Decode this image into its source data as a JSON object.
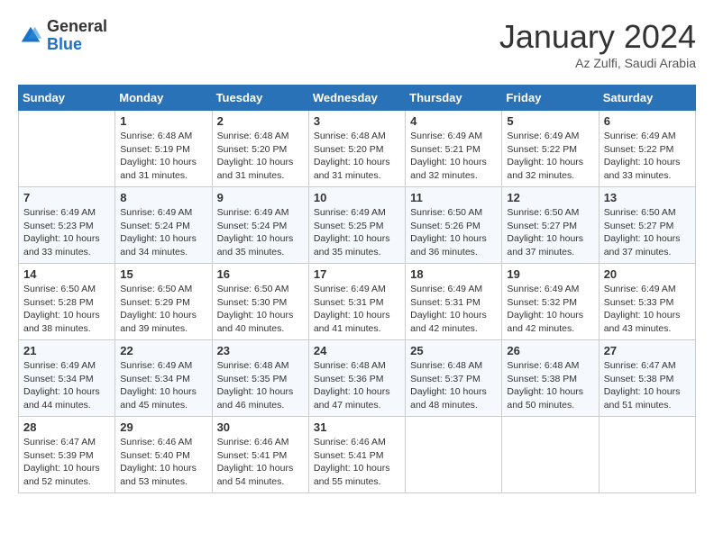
{
  "header": {
    "logo_general": "General",
    "logo_blue": "Blue",
    "month_title": "January 2024",
    "subtitle": "Az Zulfi, Saudi Arabia"
  },
  "weekdays": [
    "Sunday",
    "Monday",
    "Tuesday",
    "Wednesday",
    "Thursday",
    "Friday",
    "Saturday"
  ],
  "weeks": [
    [
      {
        "day": "",
        "info": ""
      },
      {
        "day": "1",
        "info": "Sunrise: 6:48 AM\nSunset: 5:19 PM\nDaylight: 10 hours\nand 31 minutes."
      },
      {
        "day": "2",
        "info": "Sunrise: 6:48 AM\nSunset: 5:20 PM\nDaylight: 10 hours\nand 31 minutes."
      },
      {
        "day": "3",
        "info": "Sunrise: 6:48 AM\nSunset: 5:20 PM\nDaylight: 10 hours\nand 31 minutes."
      },
      {
        "day": "4",
        "info": "Sunrise: 6:49 AM\nSunset: 5:21 PM\nDaylight: 10 hours\nand 32 minutes."
      },
      {
        "day": "5",
        "info": "Sunrise: 6:49 AM\nSunset: 5:22 PM\nDaylight: 10 hours\nand 32 minutes."
      },
      {
        "day": "6",
        "info": "Sunrise: 6:49 AM\nSunset: 5:22 PM\nDaylight: 10 hours\nand 33 minutes."
      }
    ],
    [
      {
        "day": "7",
        "info": "Sunrise: 6:49 AM\nSunset: 5:23 PM\nDaylight: 10 hours\nand 33 minutes."
      },
      {
        "day": "8",
        "info": "Sunrise: 6:49 AM\nSunset: 5:24 PM\nDaylight: 10 hours\nand 34 minutes."
      },
      {
        "day": "9",
        "info": "Sunrise: 6:49 AM\nSunset: 5:24 PM\nDaylight: 10 hours\nand 35 minutes."
      },
      {
        "day": "10",
        "info": "Sunrise: 6:49 AM\nSunset: 5:25 PM\nDaylight: 10 hours\nand 35 minutes."
      },
      {
        "day": "11",
        "info": "Sunrise: 6:50 AM\nSunset: 5:26 PM\nDaylight: 10 hours\nand 36 minutes."
      },
      {
        "day": "12",
        "info": "Sunrise: 6:50 AM\nSunset: 5:27 PM\nDaylight: 10 hours\nand 37 minutes."
      },
      {
        "day": "13",
        "info": "Sunrise: 6:50 AM\nSunset: 5:27 PM\nDaylight: 10 hours\nand 37 minutes."
      }
    ],
    [
      {
        "day": "14",
        "info": "Sunrise: 6:50 AM\nSunset: 5:28 PM\nDaylight: 10 hours\nand 38 minutes."
      },
      {
        "day": "15",
        "info": "Sunrise: 6:50 AM\nSunset: 5:29 PM\nDaylight: 10 hours\nand 39 minutes."
      },
      {
        "day": "16",
        "info": "Sunrise: 6:50 AM\nSunset: 5:30 PM\nDaylight: 10 hours\nand 40 minutes."
      },
      {
        "day": "17",
        "info": "Sunrise: 6:49 AM\nSunset: 5:31 PM\nDaylight: 10 hours\nand 41 minutes."
      },
      {
        "day": "18",
        "info": "Sunrise: 6:49 AM\nSunset: 5:31 PM\nDaylight: 10 hours\nand 42 minutes."
      },
      {
        "day": "19",
        "info": "Sunrise: 6:49 AM\nSunset: 5:32 PM\nDaylight: 10 hours\nand 42 minutes."
      },
      {
        "day": "20",
        "info": "Sunrise: 6:49 AM\nSunset: 5:33 PM\nDaylight: 10 hours\nand 43 minutes."
      }
    ],
    [
      {
        "day": "21",
        "info": "Sunrise: 6:49 AM\nSunset: 5:34 PM\nDaylight: 10 hours\nand 44 minutes."
      },
      {
        "day": "22",
        "info": "Sunrise: 6:49 AM\nSunset: 5:34 PM\nDaylight: 10 hours\nand 45 minutes."
      },
      {
        "day": "23",
        "info": "Sunrise: 6:48 AM\nSunset: 5:35 PM\nDaylight: 10 hours\nand 46 minutes."
      },
      {
        "day": "24",
        "info": "Sunrise: 6:48 AM\nSunset: 5:36 PM\nDaylight: 10 hours\nand 47 minutes."
      },
      {
        "day": "25",
        "info": "Sunrise: 6:48 AM\nSunset: 5:37 PM\nDaylight: 10 hours\nand 48 minutes."
      },
      {
        "day": "26",
        "info": "Sunrise: 6:48 AM\nSunset: 5:38 PM\nDaylight: 10 hours\nand 50 minutes."
      },
      {
        "day": "27",
        "info": "Sunrise: 6:47 AM\nSunset: 5:38 PM\nDaylight: 10 hours\nand 51 minutes."
      }
    ],
    [
      {
        "day": "28",
        "info": "Sunrise: 6:47 AM\nSunset: 5:39 PM\nDaylight: 10 hours\nand 52 minutes."
      },
      {
        "day": "29",
        "info": "Sunrise: 6:46 AM\nSunset: 5:40 PM\nDaylight: 10 hours\nand 53 minutes."
      },
      {
        "day": "30",
        "info": "Sunrise: 6:46 AM\nSunset: 5:41 PM\nDaylight: 10 hours\nand 54 minutes."
      },
      {
        "day": "31",
        "info": "Sunrise: 6:46 AM\nSunset: 5:41 PM\nDaylight: 10 hours\nand 55 minutes."
      },
      {
        "day": "",
        "info": ""
      },
      {
        "day": "",
        "info": ""
      },
      {
        "day": "",
        "info": ""
      }
    ]
  ]
}
